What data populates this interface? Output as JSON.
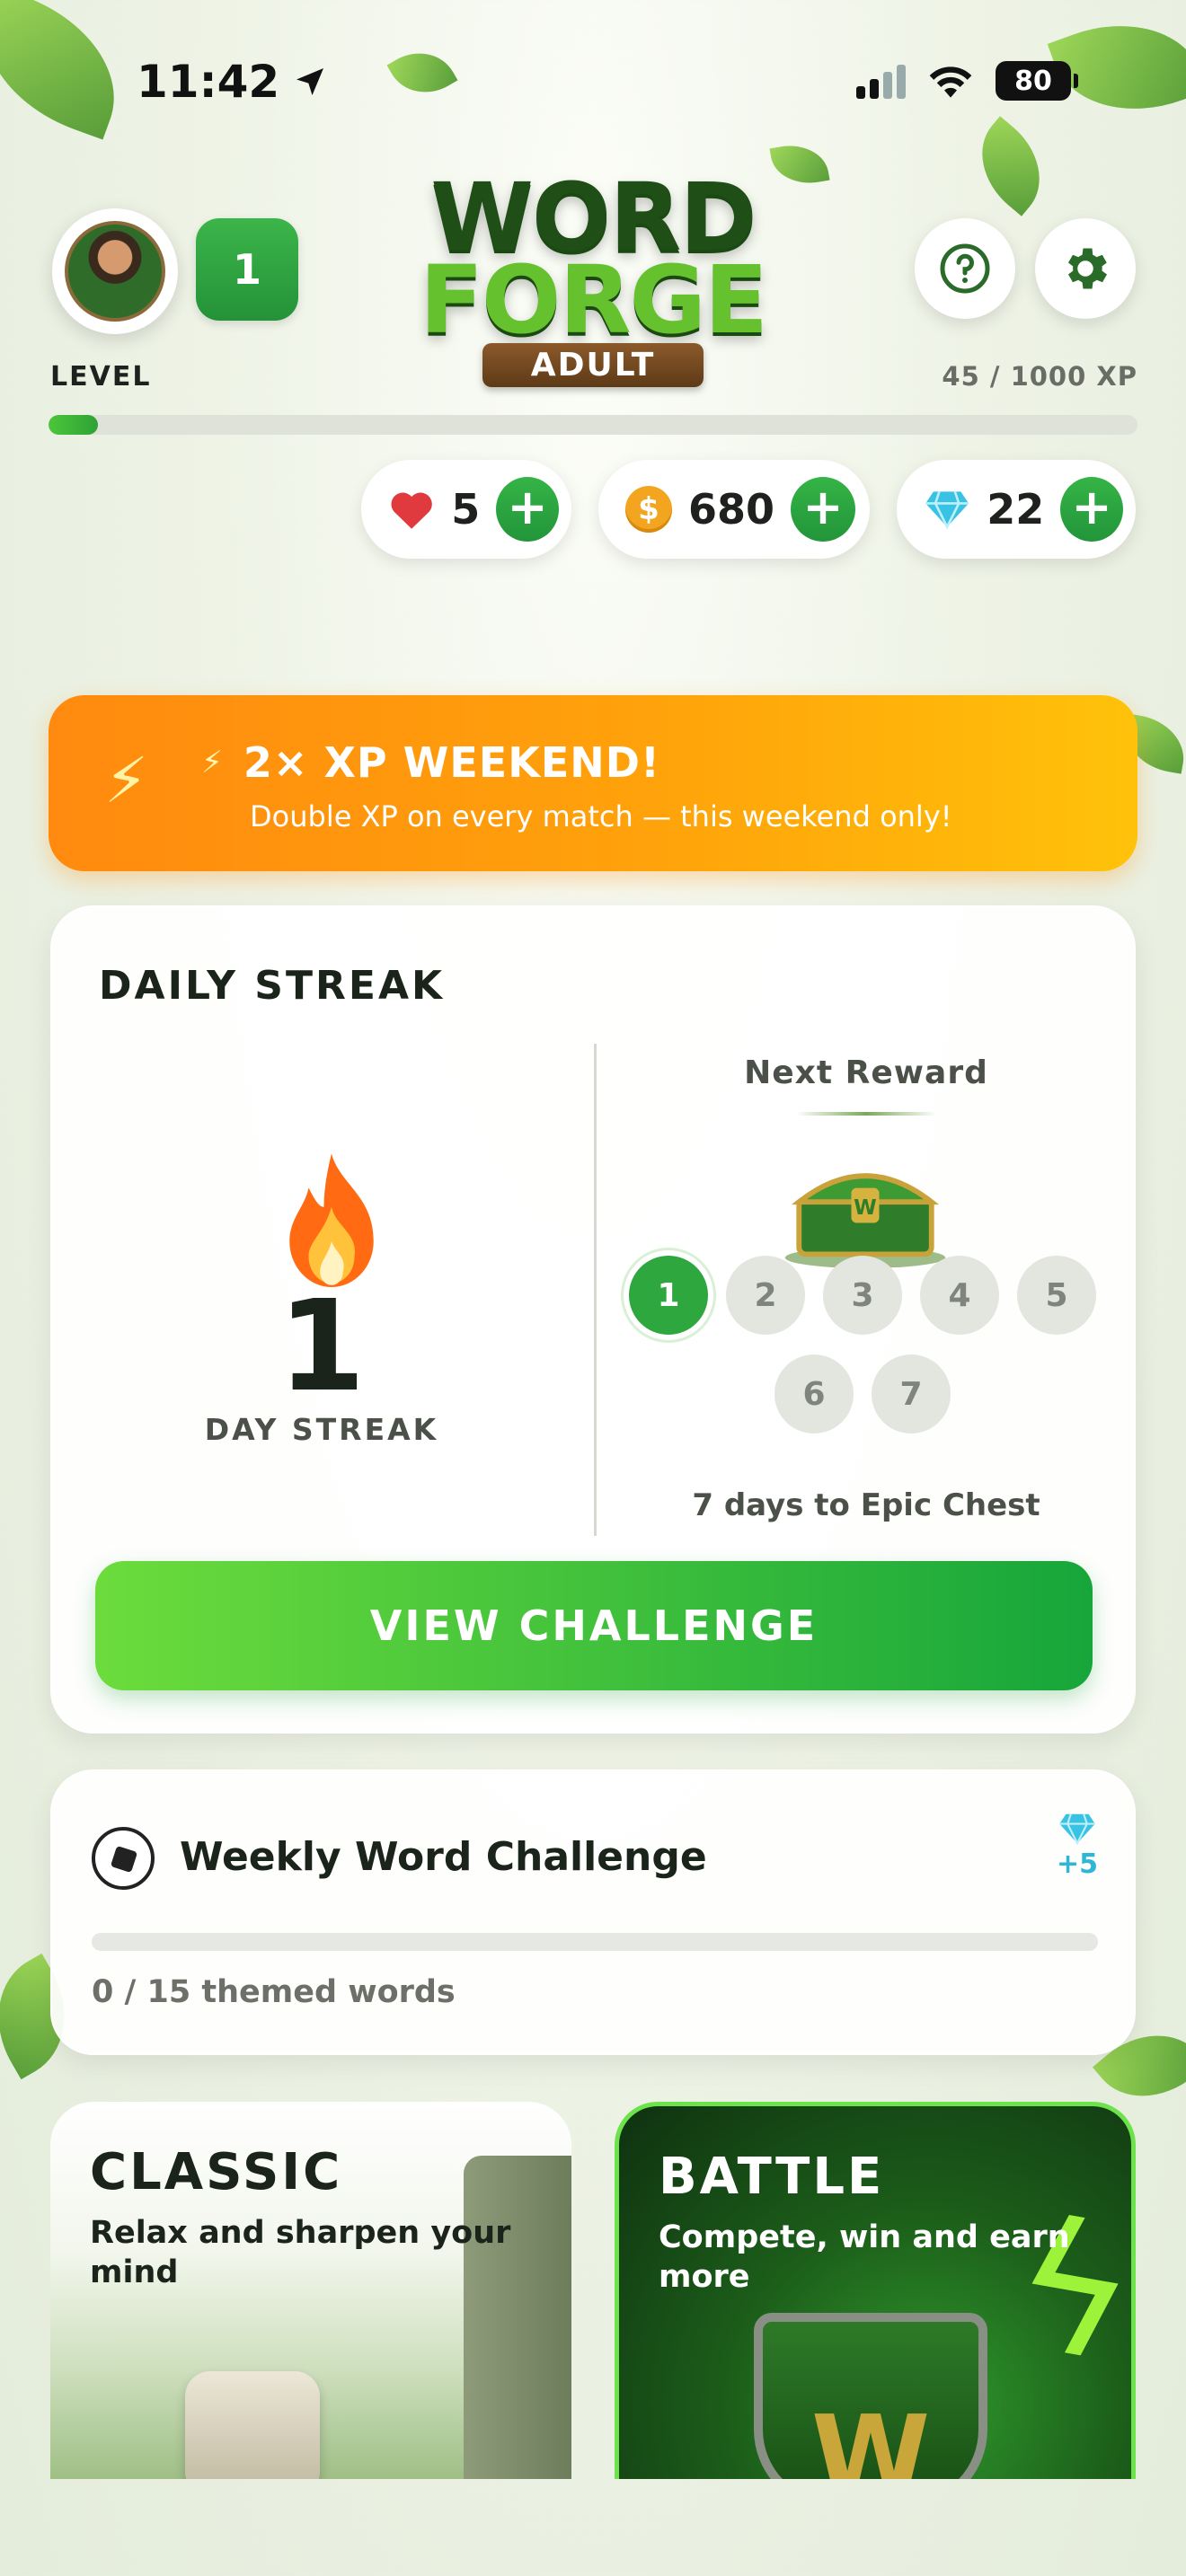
{
  "status_bar": {
    "time": "11:42",
    "battery": "80"
  },
  "header": {
    "level_value": "1",
    "level_label": "LEVEL",
    "logo_line1": "WORD",
    "logo_line2": "FORGE",
    "logo_tag": "ADULT",
    "xp_text": "45 / 1000 XP",
    "xp_progress_fraction": 0.045
  },
  "currencies": {
    "hearts": "5",
    "coins": "680",
    "coin_symbol": "$",
    "gems": "22",
    "plus": "+"
  },
  "banner": {
    "title": "2× XP WEEKEND!",
    "subtitle": "Double XP on every match — this weekend only!",
    "icon": "lightning-icon"
  },
  "streak": {
    "title": "DAILY STREAK",
    "count": "1",
    "label": "DAY STREAK",
    "next_reward_label": "Next Reward",
    "days": [
      "1",
      "2",
      "3",
      "4",
      "5",
      "6",
      "7"
    ],
    "active_day": 1,
    "caption": "7 days to Epic Chest",
    "cta": "VIEW CHALLENGE"
  },
  "weekly": {
    "title": "Weekly Word Challenge",
    "reward": "+5",
    "progress_text": "0 / 15 themed words",
    "progress_fraction": 0
  },
  "modes": {
    "classic": {
      "title": "CLASSIC",
      "subtitle": "Relax and sharpen your mind"
    },
    "battle": {
      "title": "BATTLE",
      "subtitle": "Compete, win and earn more"
    }
  },
  "colors": {
    "primary_green": "#2ea83e",
    "banner_orange": "#ff8a0f",
    "banner_yellow": "#ffc20a",
    "gem_blue": "#2fb6d6",
    "heart_red": "#e0393e"
  }
}
